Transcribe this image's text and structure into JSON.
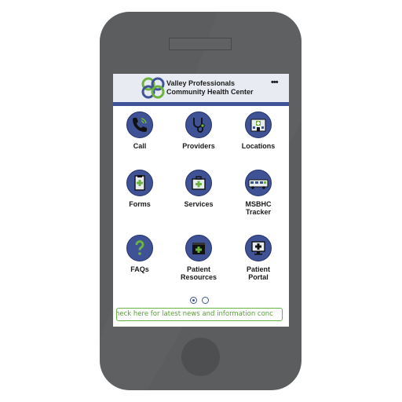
{
  "header": {
    "title_line1": "Valley Professionals",
    "title_line2": "Community Health Center",
    "more_label": "•••"
  },
  "tiles": [
    {
      "label": "Call",
      "icon": "phone-icon"
    },
    {
      "label": "Providers",
      "icon": "stethoscope-icon"
    },
    {
      "label": "Locations",
      "icon": "hospital-icon"
    },
    {
      "label": "Forms",
      "icon": "clipboard-icon"
    },
    {
      "label": "Services",
      "icon": "medical-kit-icon"
    },
    {
      "label": "MSBHC\nTracker",
      "icon": "bus-icon"
    },
    {
      "label": "FAQs",
      "icon": "question-icon"
    },
    {
      "label": "Patient\nResources",
      "icon": "first-aid-box-icon"
    },
    {
      "label": "Patient\nPortal",
      "icon": "computer-icon"
    }
  ],
  "pager": {
    "pages": 2,
    "active": 1
  },
  "ticker": {
    "text": "heck here for latest news and information conc"
  },
  "colors": {
    "primary": "#3f5496",
    "accent_green": "#68b545",
    "phone_body": "#5b5d5f"
  }
}
